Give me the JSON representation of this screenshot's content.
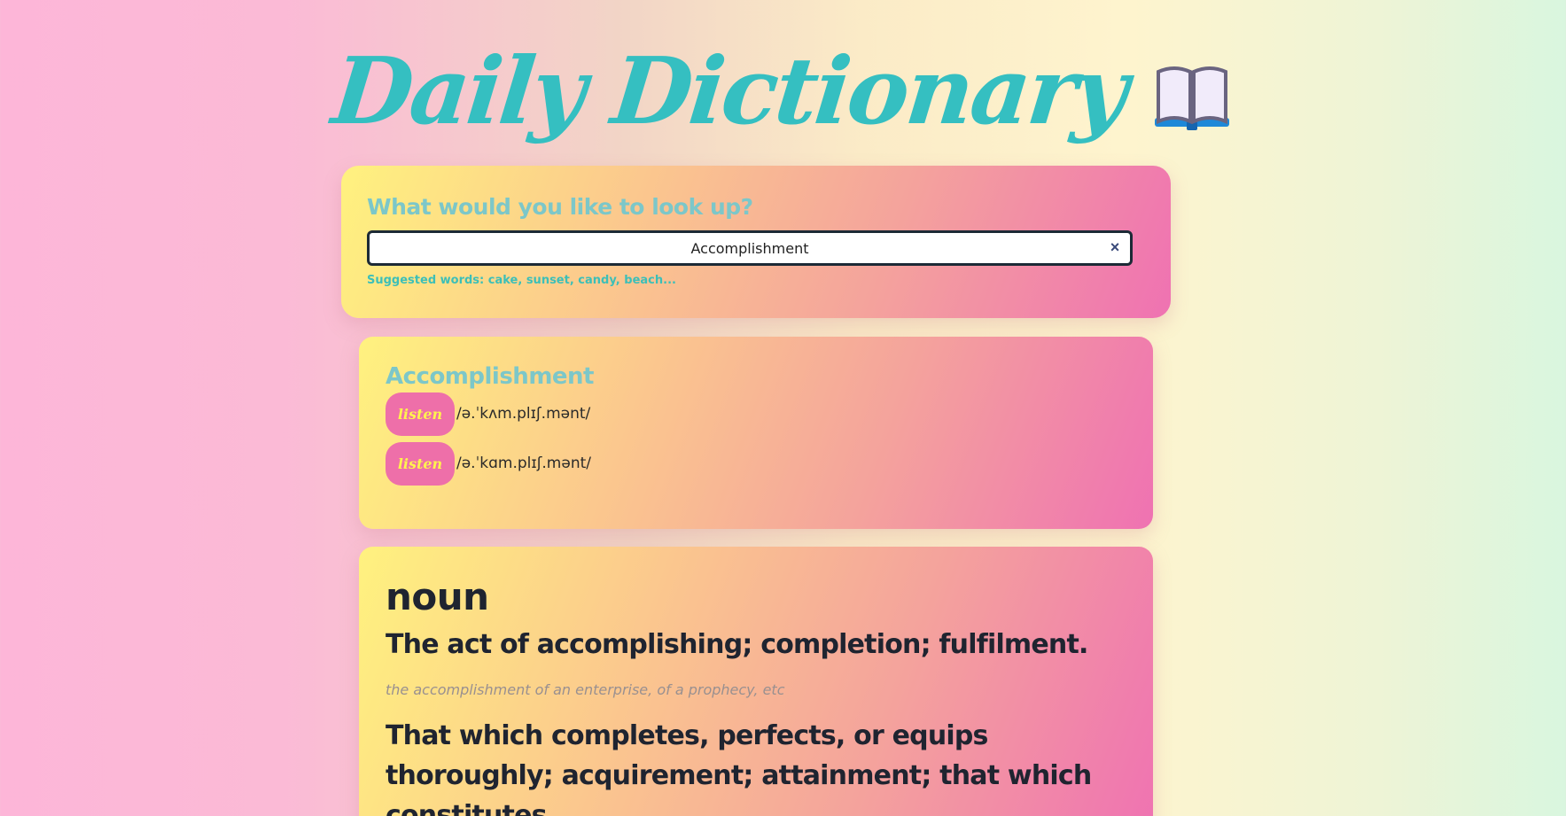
{
  "header": {
    "title": "Daily Dictionary",
    "icon": "open-book-icon"
  },
  "search": {
    "heading": "What would you like to look up?",
    "value": "Accomplishment",
    "clear_symbol": "×",
    "suggested": "Suggested words: cake, sunset, candy, beach..."
  },
  "word": {
    "title": "Accomplishment",
    "listen_label": "listen",
    "phonetics": [
      "/ə.ˈkʌm.plɪʃ.mənt/",
      "/ə.ˈkɑm.plɪʃ.mənt/"
    ]
  },
  "meaning": {
    "part_of_speech": "noun",
    "definition_1": "The act of accomplishing; completion; fulfilment.",
    "example_1": "the accomplishment of an enterprise, of a prophecy, etc",
    "definition_2": "That which completes, perfects, or equips thoroughly; acquirement; attainment; that which constitutes"
  },
  "colors": {
    "title": "#35bfc1",
    "heading": "#7cc7c9",
    "listen_bg": "#ee6fa9",
    "listen_text": "#fff34d",
    "suggested": "#3cbfb8"
  }
}
